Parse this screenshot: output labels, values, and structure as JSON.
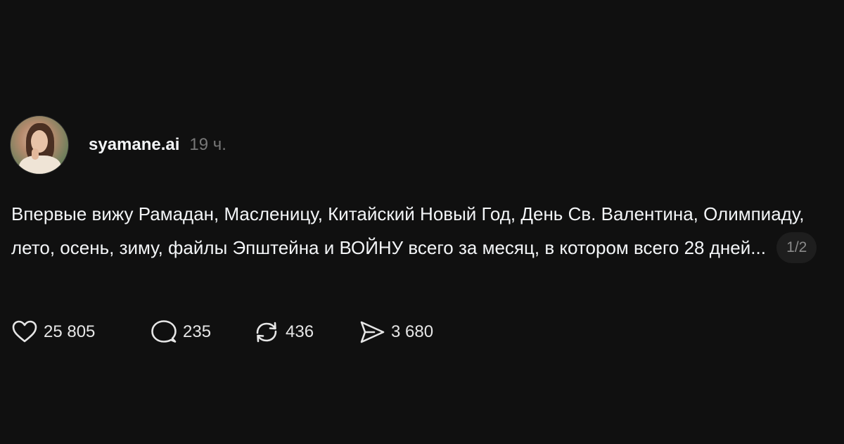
{
  "post": {
    "username": "syamane.ai",
    "time": "19 ч.",
    "text": "Впервые вижу Рамадан, Масленицу, Китайский Новый Год, День Св. Валентина, Олимпиаду, лето, осень, зиму, файлы Эпштейна и ВОЙНУ всего за месяц, в котором всего 28 дней...",
    "page_counter": "1/2"
  },
  "actions": {
    "likes": "25 805",
    "comments": "235",
    "reposts": "436",
    "shares": "3 680"
  },
  "icons": {
    "like": "heart-icon",
    "comment": "speech-bubble-icon",
    "repost": "repost-arrows-icon",
    "share": "send-icon"
  }
}
